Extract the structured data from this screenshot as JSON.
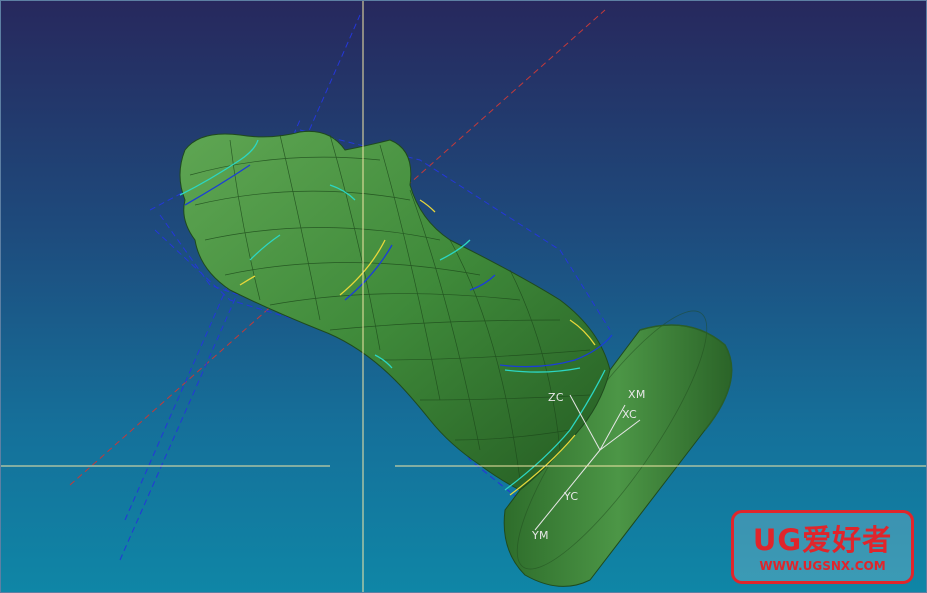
{
  "viewport": {
    "background_top": "#27285d",
    "background_bottom": "#0f86a6",
    "model_color": "#3f8a3a",
    "crosshair_color": "#f2e7a6",
    "toolpath_color": "#1a3dd8"
  },
  "axes": {
    "zc": "ZC",
    "xm": "XM",
    "xc": "XC",
    "yc": "YC",
    "ym": "YM"
  },
  "watermark": {
    "title": "UG爱好者",
    "url": "WWW.UGSNX.COM",
    "color": "#e0252b"
  }
}
